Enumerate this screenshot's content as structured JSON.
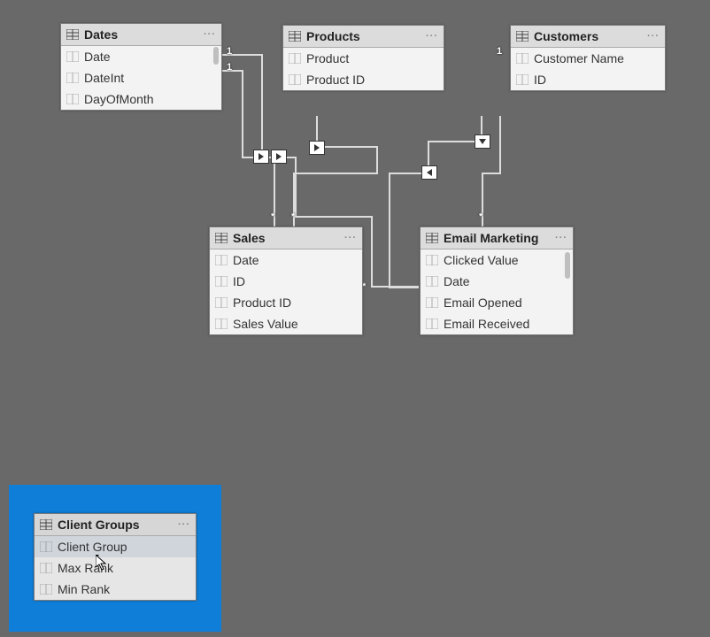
{
  "tables": {
    "dates": {
      "title": "Dates",
      "fields": [
        "Date",
        "DateInt",
        "DayOfMonth"
      ]
    },
    "products": {
      "title": "Products",
      "fields": [
        "Product",
        "Product ID"
      ]
    },
    "customers": {
      "title": "Customers",
      "fields": [
        "Customer Name",
        "ID"
      ]
    },
    "sales": {
      "title": "Sales",
      "fields": [
        "Date",
        "ID",
        "Product ID",
        "Sales Value"
      ]
    },
    "email": {
      "title": "Email Marketing",
      "fields": [
        "Clicked Value",
        "Date",
        "Email Opened",
        "Email Received"
      ]
    },
    "clientGroups": {
      "title": "Client Groups",
      "fields": [
        "Client Group",
        "Max Rank",
        "Min Rank"
      ]
    }
  },
  "relationships": [
    {
      "from": "dates",
      "to": "sales",
      "fromCard": "1",
      "toCard": "*"
    },
    {
      "from": "dates",
      "to": "email",
      "fromCard": "1",
      "toCard": "*"
    },
    {
      "from": "products",
      "to": "sales",
      "fromCard": "1",
      "toCard": "*"
    },
    {
      "from": "customers",
      "to": "sales",
      "fromCard": "1",
      "toCard": "*"
    },
    {
      "from": "customers",
      "to": "email",
      "fromCard": "1",
      "toCard": "*"
    }
  ],
  "glyphs": {
    "more": "···",
    "card_one": "1",
    "card_many": "*"
  }
}
